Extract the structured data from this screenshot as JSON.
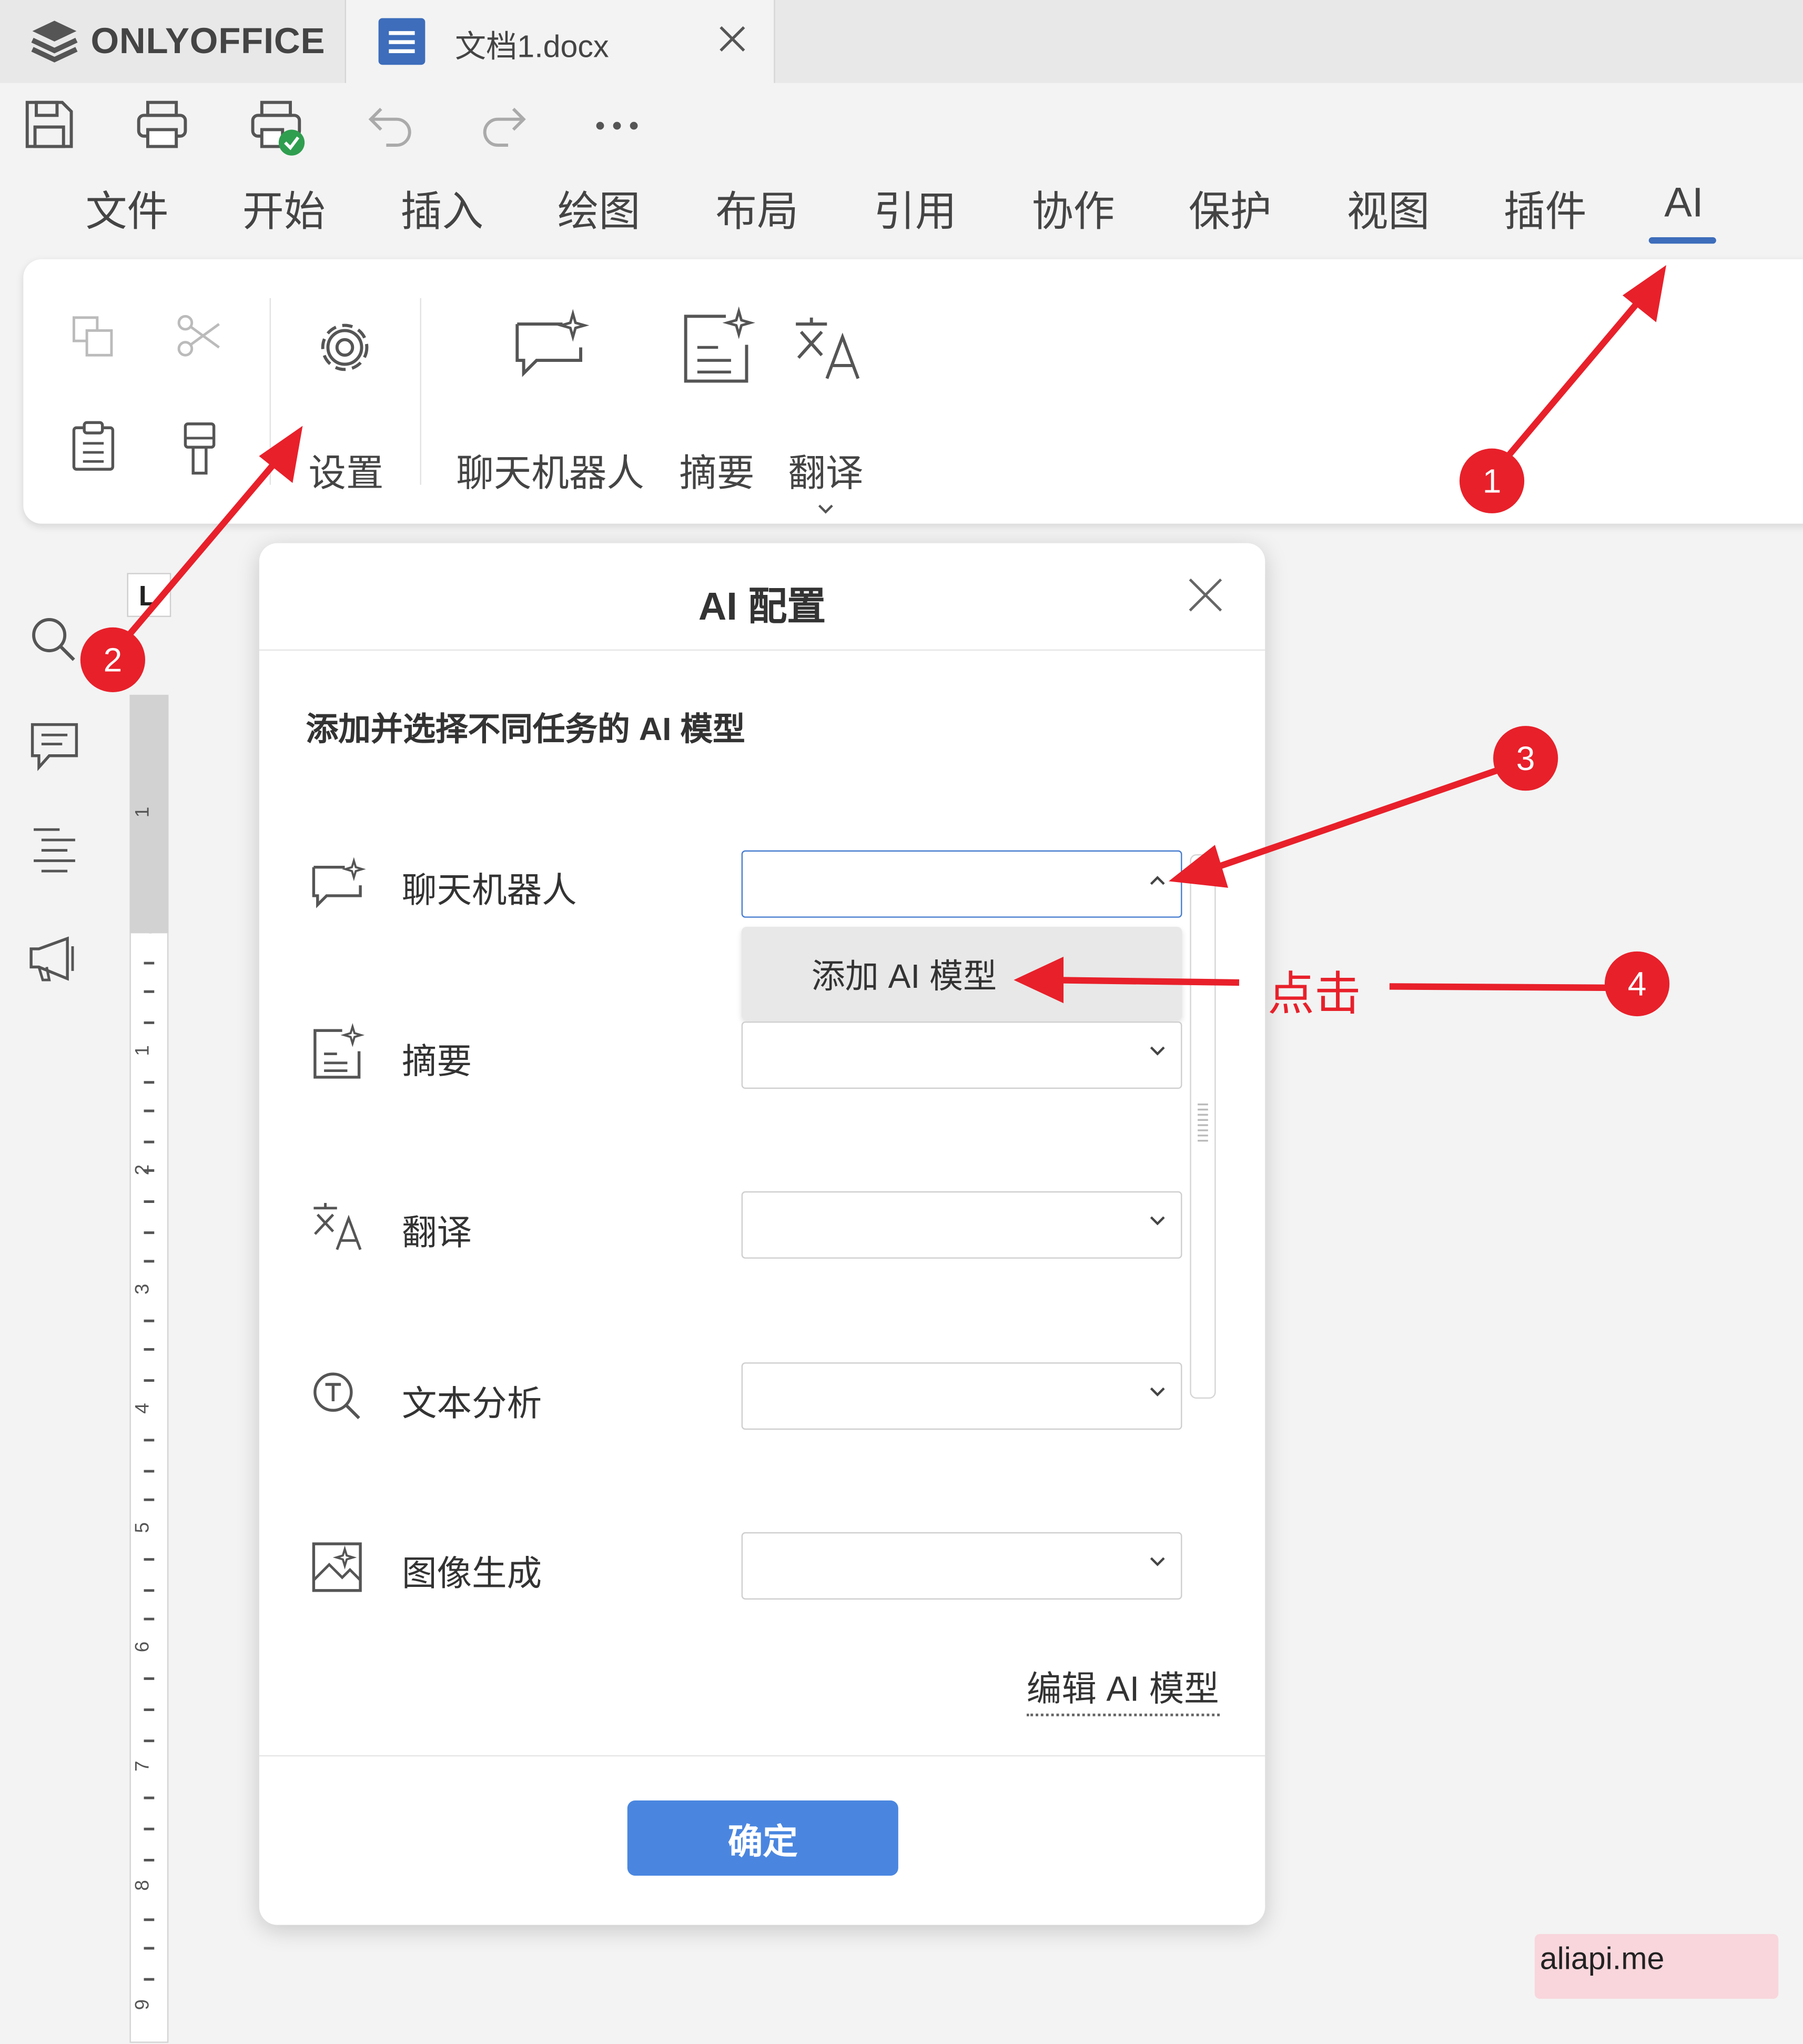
{
  "app": {
    "brand": "ONLYOFFICE",
    "document_tab": "文档1.docx"
  },
  "menu": {
    "tabs": [
      "文件",
      "开始",
      "插入",
      "绘图",
      "布局",
      "引用",
      "协作",
      "保护",
      "视图",
      "插件",
      "AI"
    ],
    "active_tab": "AI"
  },
  "toolbar": {
    "settings_label": "设置",
    "chatbot_label": "聊天机器人",
    "summary_label": "摘要",
    "translate_label": "翻译"
  },
  "ruler": {
    "numbers": [
      "1",
      "1",
      "2",
      "3",
      "4",
      "5",
      "6",
      "7",
      "8",
      "9"
    ],
    "corner": "L"
  },
  "dialog": {
    "title": "AI 配置",
    "subtitle": "添加并选择不同任务的 AI 模型",
    "rows": [
      {
        "label": "聊天机器人",
        "icon": "chatbot-icon",
        "value": ""
      },
      {
        "label": "摘要",
        "icon": "summary-icon",
        "value": ""
      },
      {
        "label": "翻译",
        "icon": "translate-icon",
        "value": ""
      },
      {
        "label": "文本分析",
        "icon": "text-analysis-icon",
        "value": ""
      },
      {
        "label": "图像生成",
        "icon": "image-generation-icon",
        "value": ""
      }
    ],
    "dropdown_option": "添加 AI 模型",
    "edit_link": "编辑 AI 模型",
    "ok_button": "确定"
  },
  "annotations": {
    "badges": [
      "1",
      "2",
      "3",
      "4"
    ],
    "click_text": "点击",
    "color": "#e8202a"
  },
  "watermark": "aliapi.me",
  "colors": {
    "accent": "#4a86e0",
    "tab_underline": "#3d6dbb",
    "annotation": "#e8202a"
  }
}
